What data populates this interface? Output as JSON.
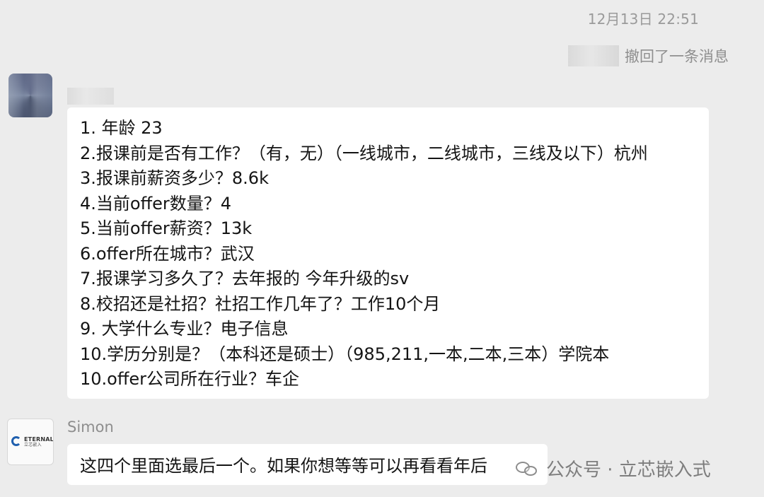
{
  "timestamp": "12月13日 22:51",
  "recall": {
    "text": "撤回了一条消息"
  },
  "messages": [
    {
      "avatar_icon": "blurred-avatar",
      "lines": [
        "1. 年龄  23",
        "2.报课前是否有工作？（有，无）（一线城市，二线城市，三线及以下）杭州",
        "3.报课前薪资多少？8.6k",
        "4.当前offer数量？4",
        "5.当前offer薪资？13k",
        "6.offer所在城市？武汉",
        "7.报课学习多久了？去年报的 今年升级的sv",
        "8.校招还是社招？社招工作几年了？工作10个月",
        "9. 大学什么专业？电子信息",
        "10.学历分别是？（本科还是硕士）（985,211,一本,二本,三本）学院本",
        "10.offer公司所在行业？车企"
      ]
    },
    {
      "sender": "Simon",
      "avatar_icon": "eternalchip-logo",
      "logo_text": "ETERNALCHIP",
      "logo_subtext": "立芯嵌入",
      "text": "这四个里面选最后一个。如果你想等等可以再看看年后"
    }
  ],
  "watermark": {
    "icon": "wechat-official-account-icon",
    "text": "公众号 · 立芯嵌入式"
  },
  "colors": {
    "background": "#ececec",
    "bubble": "#ffffff",
    "muted_text": "#9a9a9a",
    "brand_blue": "#1f5fae"
  }
}
